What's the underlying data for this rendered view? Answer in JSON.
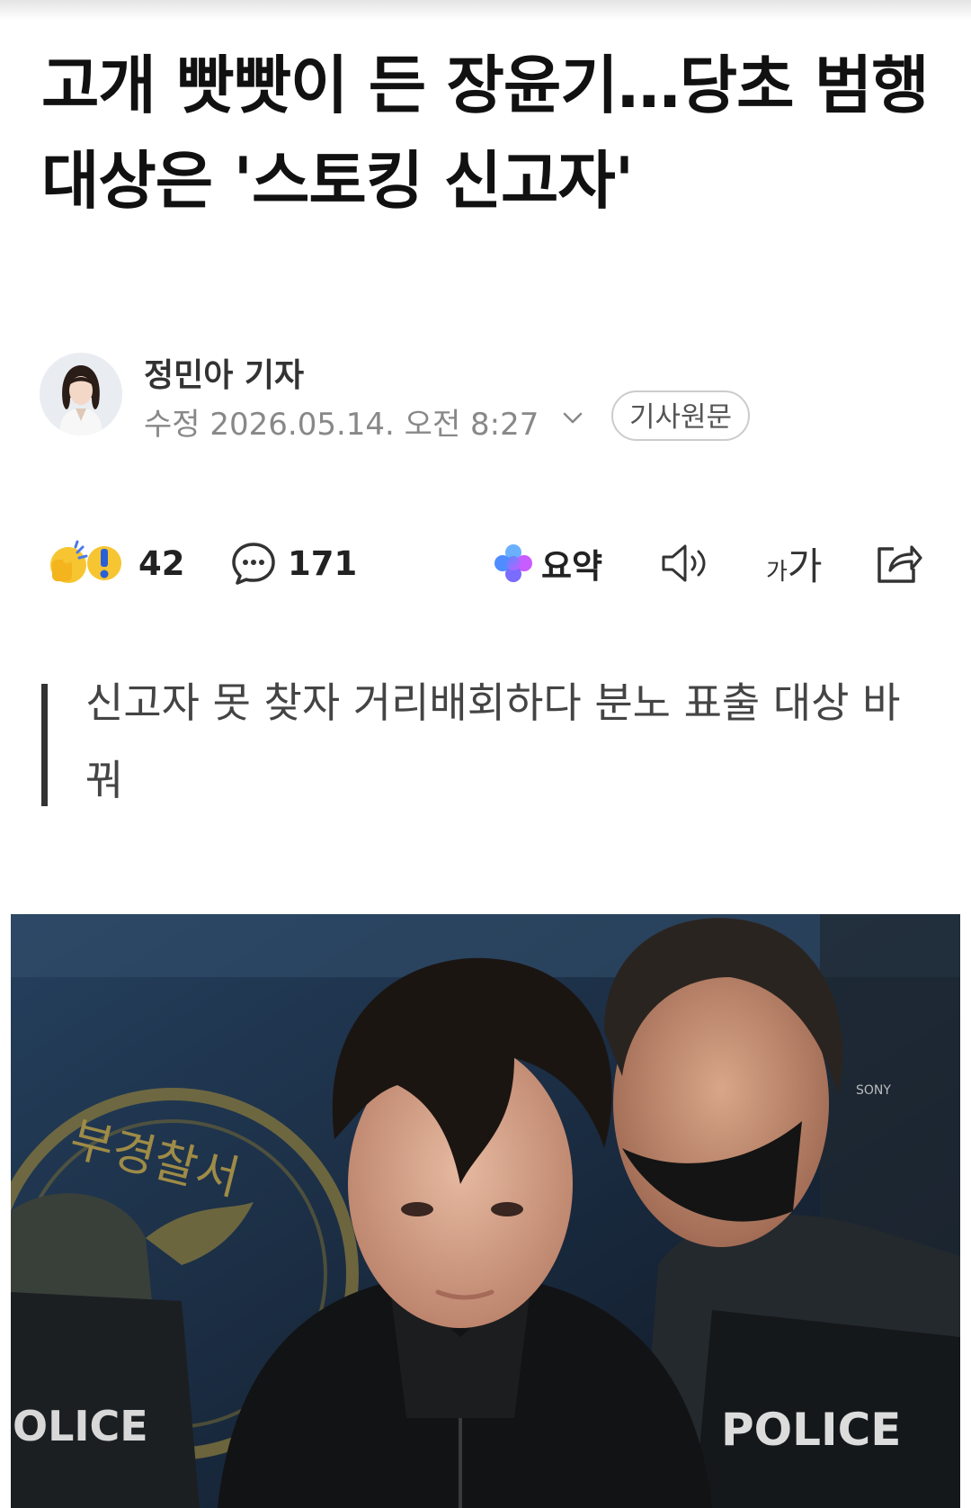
{
  "article": {
    "headline": "고개 빳빳이 든 장윤기…당초 범행 대상은 '스토킹 신고자'",
    "subheading": "신고자 못 찾자 거리배회하다 분노 표출 대상 바꿔"
  },
  "byline": {
    "reporter": "정민아 기자",
    "date_label": "수정",
    "datetime": "2026.05.14. 오전 8:27",
    "original_button": "기사원문"
  },
  "toolbar": {
    "reaction_count": "42",
    "comment_count": "171",
    "summary_label": "요약",
    "fontsize_small": "가",
    "fontsize_large": "가"
  },
  "photo": {
    "sign_text": "부경찰서",
    "vest_left": "OLICE",
    "vest_right": "POLICE",
    "camera_brand": "SONY"
  },
  "colors": {
    "text_primary": "#111111",
    "text_muted": "#888888",
    "quote_bar": "#333333",
    "summary_gradient": [
      "#4f8cff",
      "#c85cff"
    ]
  }
}
